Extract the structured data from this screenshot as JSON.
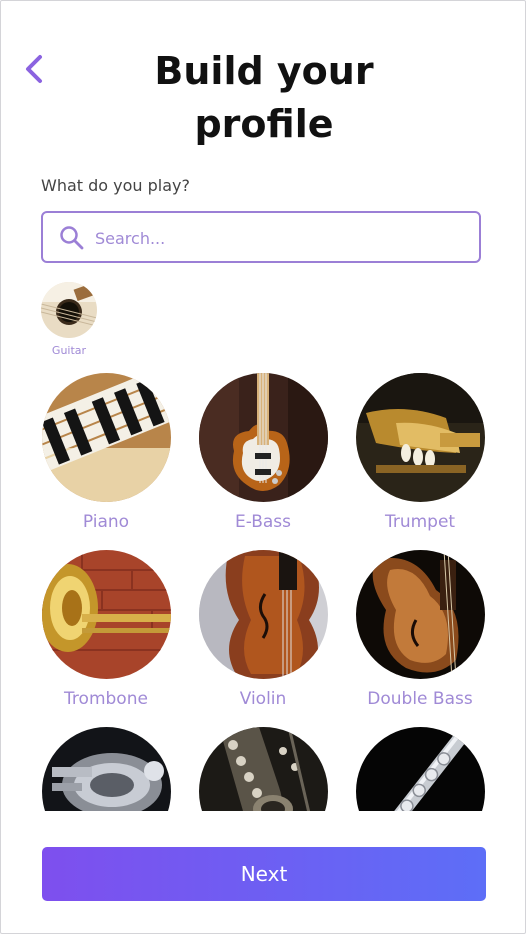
{
  "header": {
    "title": "Build your profile"
  },
  "prompt": "What do you play?",
  "search": {
    "placeholder": "Search..."
  },
  "selected": [
    {
      "label": "Guitar"
    }
  ],
  "instruments": [
    {
      "label": "Piano"
    },
    {
      "label": "E-Bass"
    },
    {
      "label": "Trumpet"
    },
    {
      "label": "Trombone"
    },
    {
      "label": "Violin"
    },
    {
      "label": "Double Bass"
    },
    {
      "label": ""
    },
    {
      "label": ""
    },
    {
      "label": ""
    }
  ],
  "footer": {
    "next_label": "Next"
  },
  "colors": {
    "accent": "#a08ad6",
    "button_start": "#7e4fee",
    "button_end": "#5d6ef7"
  }
}
